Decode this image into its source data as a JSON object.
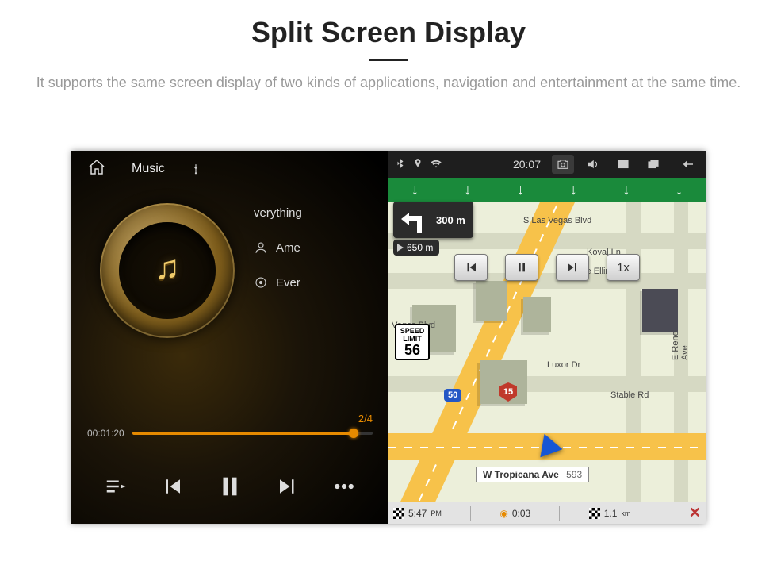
{
  "header": {
    "title": "Split Screen Display",
    "description": "It supports the same screen display of two kinds of applications, navigation and entertainment at the same time."
  },
  "music": {
    "app_label": "Music",
    "source": "USB",
    "track_title": "verything",
    "artist": "Ame",
    "album": "Ever",
    "track_index": "2/4",
    "elapsed": "00:01:20",
    "progress_pct": 92
  },
  "statusbar": {
    "time": "20:07"
  },
  "nav": {
    "turn_distance": "300 m",
    "remaining": "650 m",
    "speed_limit_label": "SPEED LIMIT",
    "speed_limit": "56",
    "route_small": "50",
    "route_shield": "15",
    "current_street": "W Tropicana Ave",
    "current_street_num": "593",
    "streets": {
      "s_las_vegas": "S Las Vegas Blvd",
      "koval": "Koval Ln",
      "duke": "Duke Ellington Dr",
      "vegas": "Vegas Blvd",
      "luxor": "Luxor Dr",
      "stable": "Stable Rd",
      "reno": "E Reno Ave"
    },
    "playback_speed": "1x",
    "eta": "5:47",
    "eta_unit": "PM",
    "trip_time": "0:03",
    "trip_dist": "1.1",
    "trip_dist_unit": "km"
  }
}
